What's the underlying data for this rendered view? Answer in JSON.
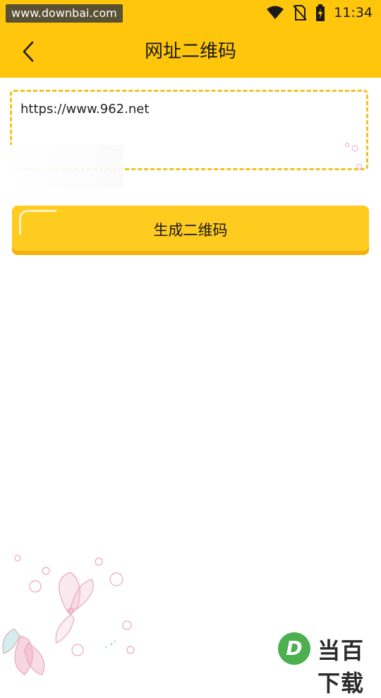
{
  "status_bar": {
    "watermark": "www.downbai.com",
    "time": "11:34",
    "icons": [
      "wifi-icon",
      "no-sim-icon",
      "battery-charging-icon"
    ]
  },
  "app_bar": {
    "back_icon": "chevron-left-icon",
    "title": "网址二维码"
  },
  "url_input": {
    "value": "https://www.962.net"
  },
  "generate_button": {
    "label": "生成二维码"
  },
  "brand": {
    "logo_letter": "D",
    "name": "当百下载"
  },
  "colors": {
    "primary": "#ffc60b",
    "button": "#fecb1f",
    "dashed_border": "#f0c420",
    "brand_green": "#4caf50"
  }
}
